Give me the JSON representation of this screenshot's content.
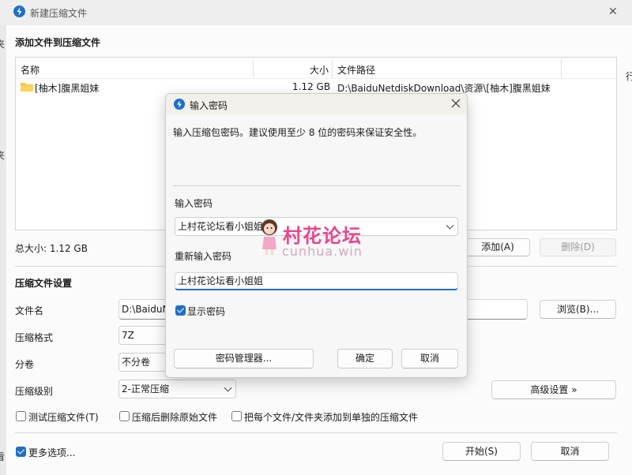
{
  "window": {
    "title": "新建压缩文件",
    "close": "✕"
  },
  "left_edge_glyphs": [
    "夹",
    "夹",
    "看"
  ],
  "right_edge_glyph": "行",
  "files_section": {
    "heading": "添加文件到压缩文件",
    "columns": [
      "名称",
      "大小",
      "文件路径"
    ],
    "rows": [
      {
        "name": "[柚木]腹黑姐妹",
        "size": "1.12 GB",
        "path": "D:\\BaiduNetdiskDownload\\资源\\[柚木]腹黑姐妹"
      }
    ],
    "total_size": "总大小: 1.12 GB",
    "add_button": "添加(A)",
    "delete_button": "删除(D)"
  },
  "settings": {
    "heading": "压缩文件设置",
    "filename_label": "文件名",
    "filename_value": "D:\\BaiduN",
    "browse_button": "浏览(B)...",
    "format_label": "压缩格式",
    "format_value": "7Z",
    "split_label": "分卷",
    "split_value": "不分卷",
    "level_label": "压缩级别",
    "level_value": "2-正常压缩",
    "advanced_button": "高级设置 »",
    "test_checkbox": "测试压缩文件(T)",
    "delete_after_checkbox": "压缩后删除原始文件",
    "each_separate_checkbox": "把每个文件/文件夹添加到单独的压缩文件",
    "more_options": "更多选项...",
    "start_button": "开始(S)",
    "cancel_button": "取消"
  },
  "password_dialog": {
    "title": "输入密码",
    "description": "输入压缩包密码。建议使用至少 8 位的密码来保证安全性。",
    "password_label": "输入密码",
    "password_value": "上村花论坛看小姐姐",
    "reenter_label": "重新输入密码",
    "reenter_value": "上村花论坛看小姐姐",
    "show_password": "显示密码",
    "manager_button": "密码管理器...",
    "ok_button": "确定",
    "cancel_button": "取消"
  },
  "watermark": {
    "text": "村花论坛",
    "url": "cunhua.win"
  },
  "colors": {
    "accent": "#1f6fc5",
    "watermark_pink": "#e8478c",
    "watermark_url": "#d4a8c0"
  }
}
